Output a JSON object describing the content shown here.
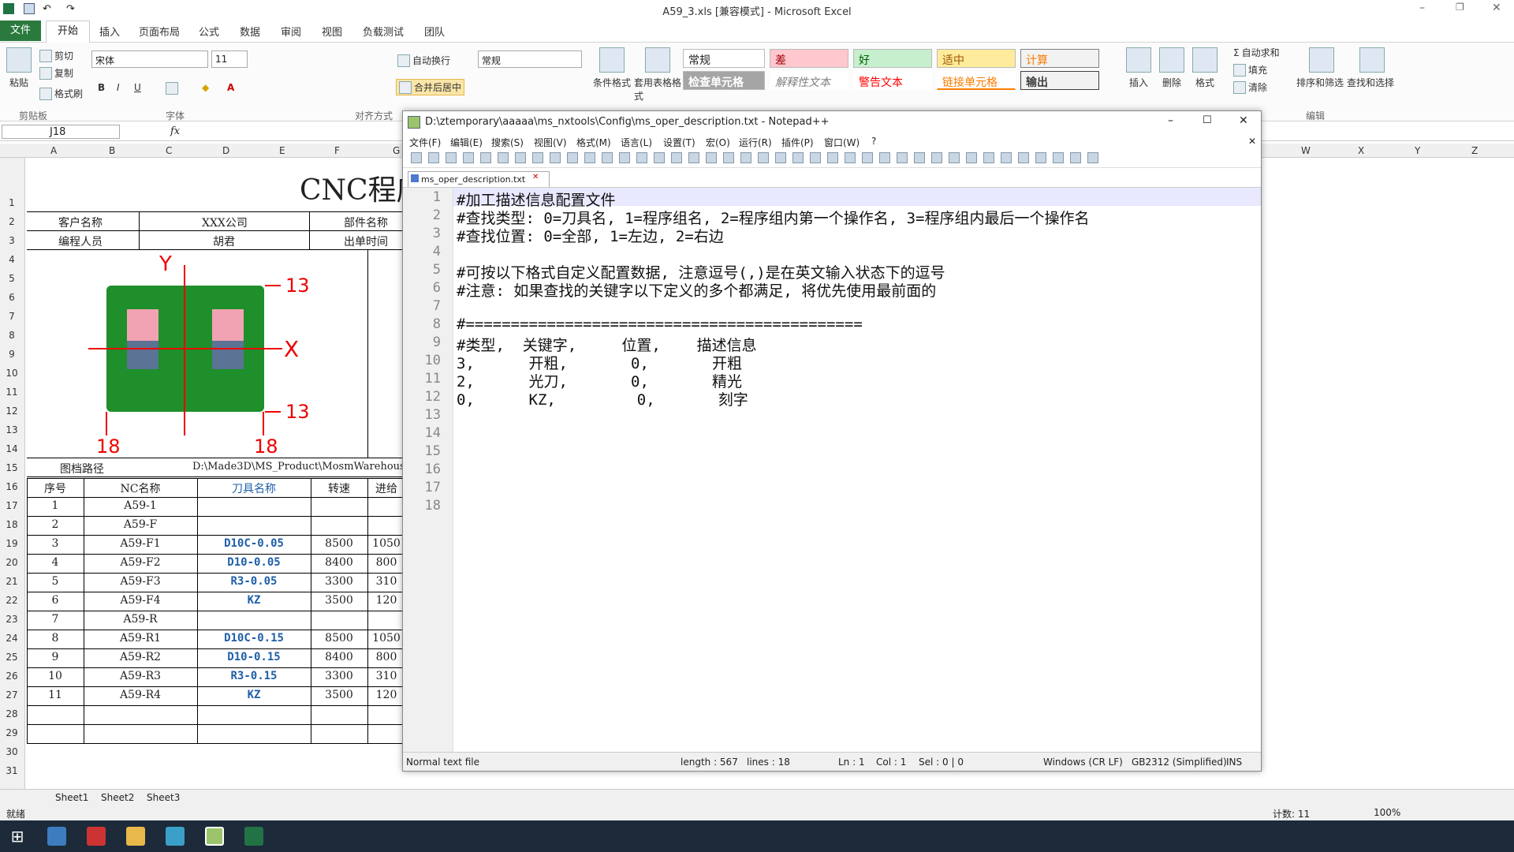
{
  "excel": {
    "title": "A59_3.xls  [兼容模式] - Microsoft Excel",
    "tabs": [
      "文件",
      "开始",
      "插入",
      "页面布局",
      "公式",
      "数据",
      "审阅",
      "视图",
      "负载测试",
      "团队"
    ],
    "clipboard": {
      "paste": "粘贴",
      "cut": "剪切",
      "copy": "复制",
      "format_painter": "格式刷",
      "group": "剪贴板"
    },
    "font": {
      "name": "宋体",
      "size": "11",
      "group": "字体"
    },
    "alignment": {
      "wrap": "自动换行",
      "merge": "合并后居中",
      "group": "对齐方式"
    },
    "number": {
      "format": "常规"
    },
    "styles": {
      "conditional": "条件格式",
      "table": "套用表格格式",
      "normal": "常规",
      "bad": "差",
      "good": "好",
      "neutral": "适中",
      "calc": "计算",
      "check": "检查单元格",
      "explanatory": "解释性文本",
      "warning": "警告文本",
      "linked": "链接单元格",
      "output": "输出"
    },
    "cells_group": {
      "insert": "插入",
      "delete": "删除",
      "format": "格式"
    },
    "editing": {
      "autosum": "自动求和",
      "fill": "填充",
      "clear": "清除",
      "sort": "排序和筛选",
      "find": "查找和选择",
      "group": "编辑"
    },
    "name_box": "J18",
    "fx": "fx",
    "columns_left": [
      "A",
      "B",
      "C",
      "D",
      "E",
      "F",
      "G"
    ],
    "columns_right": [
      "W",
      "X",
      "Y",
      "Z"
    ],
    "rows": [
      "1",
      "2",
      "3",
      "4",
      "5",
      "6",
      "7",
      "8",
      "9",
      "10",
      "11",
      "12",
      "13",
      "14",
      "15",
      "16",
      "17",
      "18",
      "19",
      "20",
      "21",
      "22",
      "23",
      "24",
      "25",
      "26",
      "27",
      "28",
      "29",
      "30",
      "31"
    ],
    "sheet_title": "CNC程序",
    "info": {
      "customer_label": "客户名称",
      "customer": "XXX公司",
      "part_label": "部件名称",
      "programmer_label": "编程人员",
      "programmer": "胡君",
      "time_label": "出单时间",
      "path_label": "图档路径",
      "path": "D:\\Made3D\\MS_Product\\MosmWarehous"
    },
    "drawing": {
      "y": "Y",
      "x": "X",
      "d1": "13",
      "d2": "13",
      "d3": "18",
      "d4": "18"
    },
    "table_headers": [
      "序号",
      "NC名称",
      "刀具名称",
      "转速",
      "进给"
    ],
    "table_rows": [
      [
        "1",
        "A59-1",
        "",
        "",
        ""
      ],
      [
        "2",
        "A59-F",
        "",
        "",
        ""
      ],
      [
        "3",
        "A59-F1",
        "D10C-0.05",
        "8500",
        "1050"
      ],
      [
        "4",
        "A59-F2",
        "D10-0.05",
        "8400",
        "800"
      ],
      [
        "5",
        "A59-F3",
        "R3-0.05",
        "3300",
        "310"
      ],
      [
        "6",
        "A59-F4",
        "KZ",
        "3500",
        "120"
      ],
      [
        "7",
        "A59-R",
        "",
        "",
        ""
      ],
      [
        "8",
        "A59-R1",
        "D10C-0.15",
        "8500",
        "1050"
      ],
      [
        "9",
        "A59-R2",
        "D10-0.15",
        "8400",
        "800"
      ],
      [
        "10",
        "A59-R3",
        "R3-0.15",
        "3300",
        "310"
      ],
      [
        "11",
        "A59-R4",
        "KZ",
        "3500",
        "120"
      ]
    ],
    "sheets": [
      "Sheet1",
      "Sheet2",
      "Sheet3"
    ],
    "status_ready": "就绪",
    "count": "计数: 11",
    "zoom": "100%"
  },
  "npp": {
    "title": "D:\\ztemporary\\aaaaa\\ms_nxtools\\Config\\ms_oper_description.txt - Notepad++",
    "menus": [
      "文件(F)",
      "编辑(E)",
      "搜索(S)",
      "视图(V)",
      "格式(M)",
      "语言(L)",
      "设置(T)",
      "宏(O)",
      "运行(R)",
      "插件(P)",
      "窗口(W)",
      "?"
    ],
    "tab": "ms_oper_description.txt",
    "lines": [
      "#加工描述信息配置文件",
      "#查找类型: 0=刀具名, 1=程序组名, 2=程序组内第一个操作名, 3=程序组内最后一个操作名",
      "#查找位置: 0=全部, 1=左边, 2=右边",
      "",
      "#可按以下格式自定义配置数据, 注意逗号(,)是在英文输入状态下的逗号",
      "#注意: 如果查找的关键字以下定义的多个都满足, 将优先使用最前面的",
      "",
      "#============================================",
      "#类型,  关键字,     位置,    描述信息",
      "3,      开粗,       0,       开粗",
      "2,      光刀,       0,       精光",
      "0,      KZ,         0,       刻字",
      "",
      "",
      "",
      "",
      "",
      ""
    ],
    "line_numbers": [
      "1",
      "2",
      "3",
      "4",
      "5",
      "6",
      "7",
      "8",
      "9",
      "10",
      "11",
      "12",
      "13",
      "14",
      "15",
      "16",
      "17",
      "18"
    ],
    "status": {
      "type": "Normal text file",
      "length": "length : 567",
      "lines": "lines : 18",
      "ln": "Ln : 1",
      "col": "Col : 1",
      "sel": "Sel : 0 | 0",
      "eol": "Windows (CR LF)",
      "enc": "GB2312 (Simplified)",
      "ins": "INS"
    }
  },
  "colors": {
    "excel_green": "#217346",
    "tool_blue": "#1f5fa8",
    "part_green": "#1e8f2a",
    "pink": "#f2a3b3",
    "steel": "#5b7394"
  }
}
